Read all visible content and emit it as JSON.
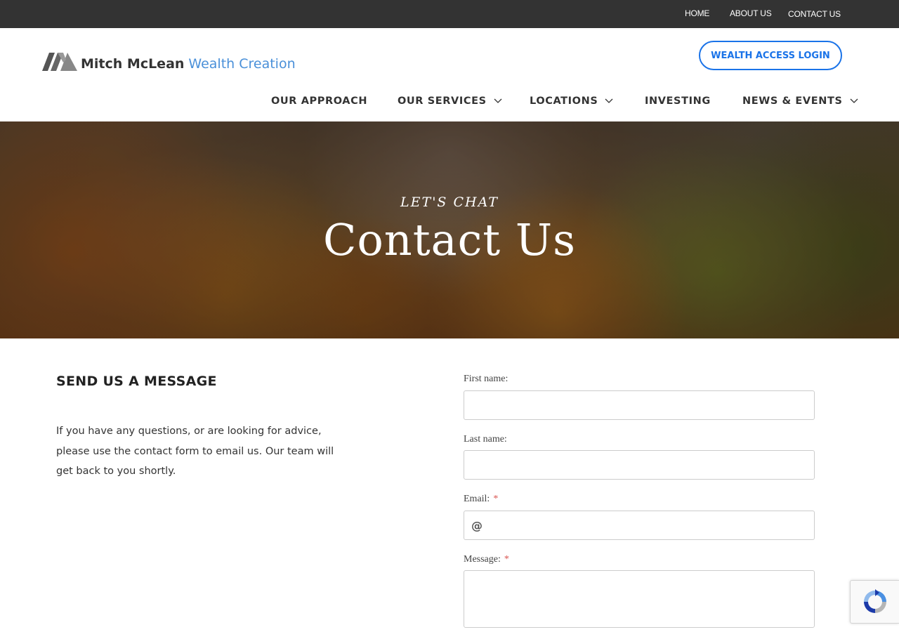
{
  "utility_nav": {
    "home": "HOME",
    "about": "ABOUT US",
    "contact": "CONTACT US"
  },
  "brand": {
    "name": "Mitch McLean",
    "tagline": "Wealth Creation",
    "accent_color": "#4a90d9"
  },
  "header": {
    "login_label": "WEALTH ACCESS LOGIN",
    "login_color": "#1a73e8"
  },
  "main_nav": {
    "items": [
      {
        "label": "OUR APPROACH",
        "has_dropdown": false
      },
      {
        "label": "OUR SERVICES",
        "has_dropdown": true
      },
      {
        "label": "LOCATIONS",
        "has_dropdown": true
      },
      {
        "label": "INVESTING",
        "has_dropdown": false
      },
      {
        "label": "NEWS & EVENTS",
        "has_dropdown": true
      }
    ]
  },
  "hero": {
    "kicker": "LET'S CHAT",
    "title": "Contact Us"
  },
  "content": {
    "heading": "SEND US A MESSAGE",
    "intro": "If you have any questions, or are looking for advice, please use the contact form to email us. Our team will get back to you shortly."
  },
  "form": {
    "first_name_label": "First name:",
    "last_name_label": "Last name:",
    "email_label": "Email:",
    "message_label": "Message:",
    "required_mark": "*",
    "email_icon": "@",
    "first_name_value": "",
    "last_name_value": "",
    "email_value": "",
    "message_value": ""
  },
  "icons": {
    "logo": "brand-logo-mark",
    "dropdown": "chevron-down-icon",
    "email": "at-icon",
    "captcha": "recaptcha-icon"
  }
}
